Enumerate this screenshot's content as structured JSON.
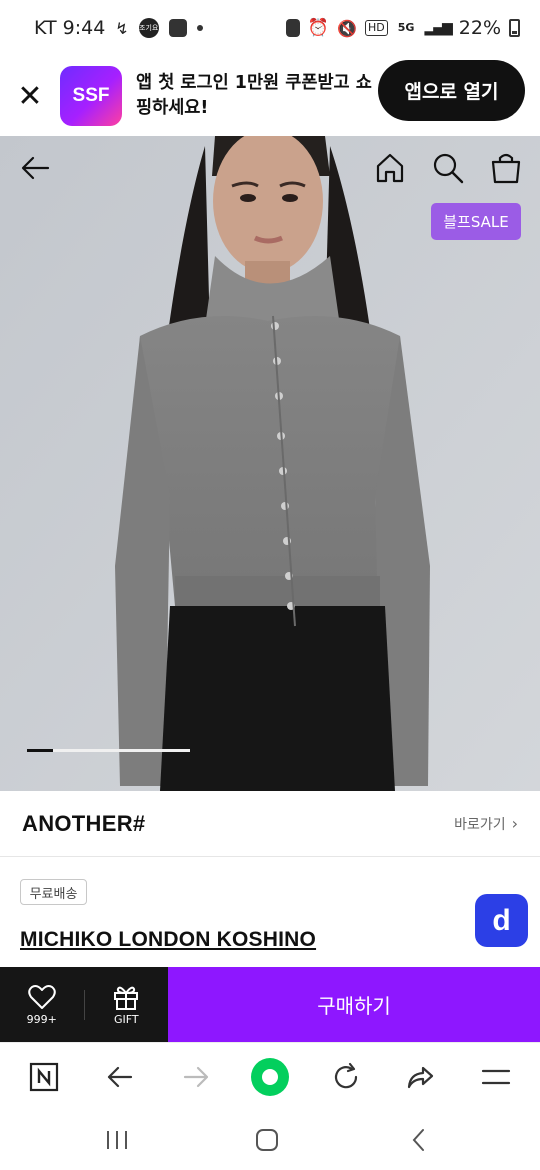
{
  "status_bar": {
    "carrier_time": "KT 9:44",
    "notification_badge": "조기요",
    "hd_label": "HD",
    "network_label": "5G",
    "battery": "22%"
  },
  "app_banner": {
    "logo_text": "SSF",
    "message": "앱 첫 로그인 1만원 쿠폰받고 쇼핑하세요!",
    "open_button": "앱으로 열기"
  },
  "hero": {
    "sale_badge": "블프SALE",
    "slide_progress": 0.16,
    "icons": [
      "back-arrow-icon",
      "home-icon",
      "search-icon",
      "shopping-bag-icon"
    ]
  },
  "brand": {
    "name": "ANOTHER#",
    "link_label": "바로가기"
  },
  "product": {
    "shipping_tag": "무료배송",
    "name": "MICHIKO LONDON KOSHINO",
    "floating_icon_letter": "d"
  },
  "buy_bar": {
    "like_count": "999+",
    "gift_label": "GIFT",
    "buy_button": "구매하기"
  },
  "browser_bar": {
    "icons": [
      "naver-n-icon",
      "back-icon",
      "forward-icon",
      "home-circle-icon",
      "reload-icon",
      "share-icon",
      "menu-icon"
    ]
  },
  "colors": {
    "accent_purple": "#8e17ff",
    "sale_badge": "#9b5ce6",
    "floating_blue": "#2c3fe6",
    "naver_green": "#03cf5d"
  }
}
